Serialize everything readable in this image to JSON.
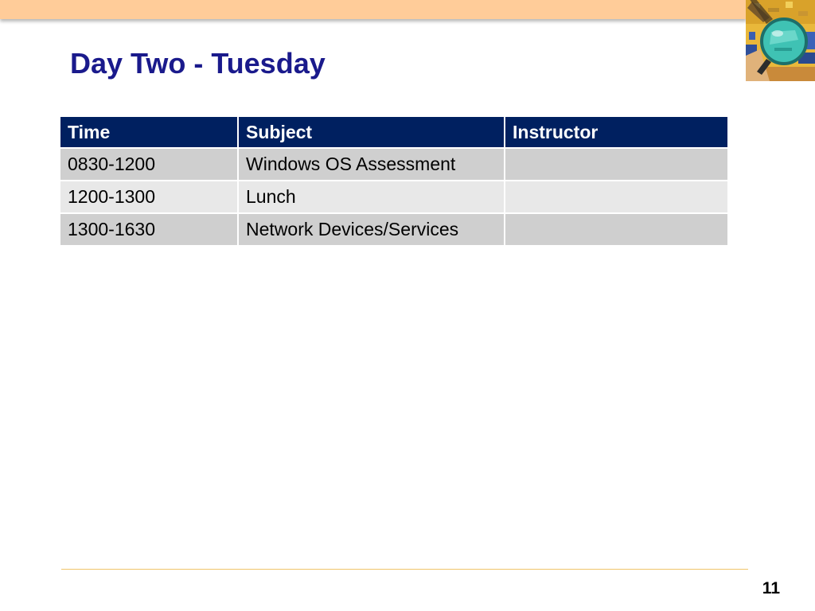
{
  "slide": {
    "title": "Day Two - Tuesday",
    "page_number": "11"
  },
  "table": {
    "headers": [
      "Time",
      "Subject",
      "Instructor"
    ],
    "rows": [
      [
        "0830-1200",
        "Windows OS Assessment",
        ""
      ],
      [
        "1200-1300",
        "Lunch",
        ""
      ],
      [
        "1300-1630",
        "Network Devices/Services",
        ""
      ]
    ]
  },
  "colors": {
    "title": "#1a1a8c",
    "header_background": "#002060",
    "top_bar": "#ffcc99",
    "row_odd": "#cfcfcf",
    "row_even": "#e8e8e8",
    "footer_line": "#f0c56a"
  },
  "icons": {
    "corner_image": "magnifying-glass-icon"
  }
}
